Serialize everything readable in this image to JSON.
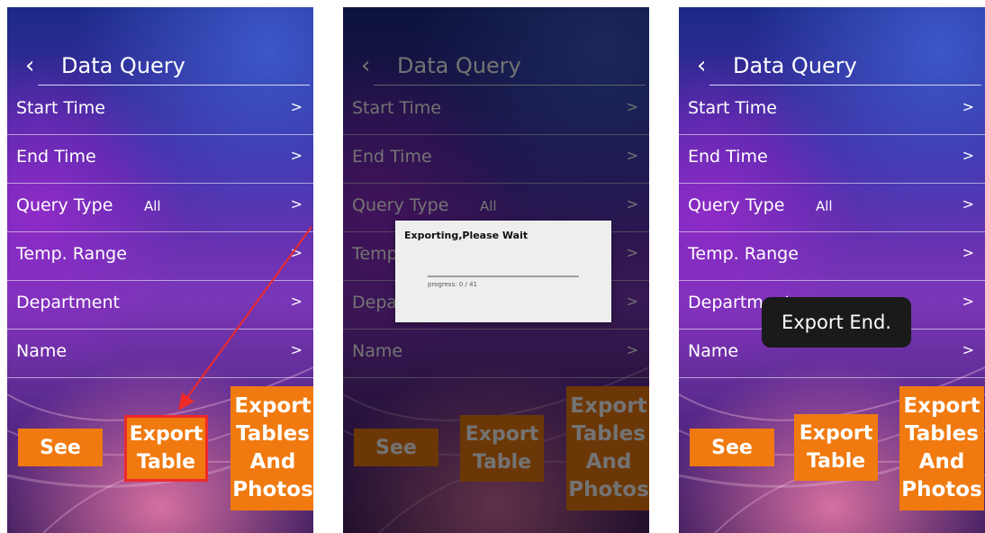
{
  "header": {
    "back_icon": "‹",
    "title": "Data Query"
  },
  "menu": [
    {
      "label": "Start Time",
      "value": ""
    },
    {
      "label": "End Time",
      "value": ""
    },
    {
      "label": "Query Type",
      "value": "All"
    },
    {
      "label": "Temp. Range",
      "value": ""
    },
    {
      "label": "Department",
      "value": ""
    },
    {
      "label": "Name",
      "value": ""
    }
  ],
  "chevron": ">",
  "buttons": {
    "see": "See",
    "export_table_1": "Export",
    "export_table_2": "Table",
    "export_all_1": "Export",
    "export_all_2": "Tables",
    "export_all_3": "And",
    "export_all_4": "Photos"
  },
  "dialog": {
    "title": "Exporting,Please Wait",
    "progress_text": "progress: 0 / 41",
    "progress": 0
  },
  "toast": "Export End.",
  "colors": {
    "button": "#f07a10",
    "highlight": "#ee2a2a",
    "arrow": "#ee2a2a"
  }
}
